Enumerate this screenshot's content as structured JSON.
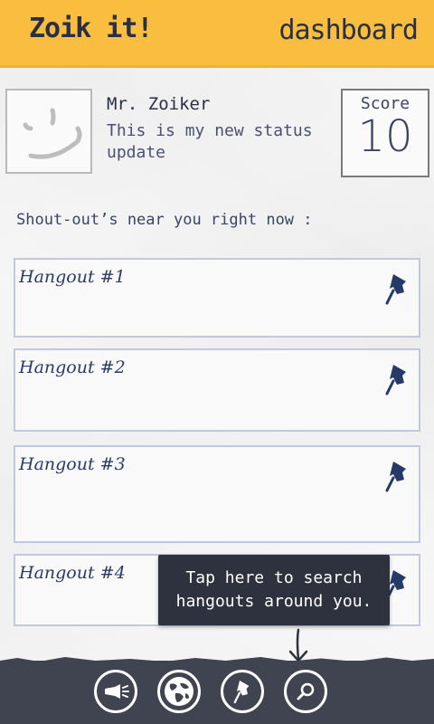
{
  "header": {
    "app_title": "Zoik it!",
    "dashboard_link": "dashboard"
  },
  "profile": {
    "name": "Mr. Zoiker",
    "status": "This is my new status update",
    "score_label": "Score",
    "score_value": "10"
  },
  "section_title": "Shout-out’s near you right now :",
  "hangouts": [
    {
      "title": "Hangout #1",
      "pin_icon": "pushpin-icon"
    },
    {
      "title": "Hangout #2",
      "pin_icon": "pushpin-icon"
    },
    {
      "title": "Hangout #3",
      "pin_icon": "pushpin-icon"
    },
    {
      "title": "Hangout #4",
      "pin_icon": "pushpin-icon"
    }
  ],
  "tooltip": {
    "line1": "Tap here to search",
    "line2": "hangouts around you."
  },
  "appbar": {
    "buttons": [
      {
        "icon": "megaphone-icon"
      },
      {
        "icon": "globe-icon"
      },
      {
        "icon": "pushpin-icon"
      },
      {
        "icon": "search-icon"
      }
    ]
  },
  "colors": {
    "header_bg": "#f9bd3f",
    "appbar_bg": "#3f4450",
    "tooltip_bg": "#2d323e",
    "pin_color": "#253a66",
    "text_primary": "#2b2f45"
  }
}
